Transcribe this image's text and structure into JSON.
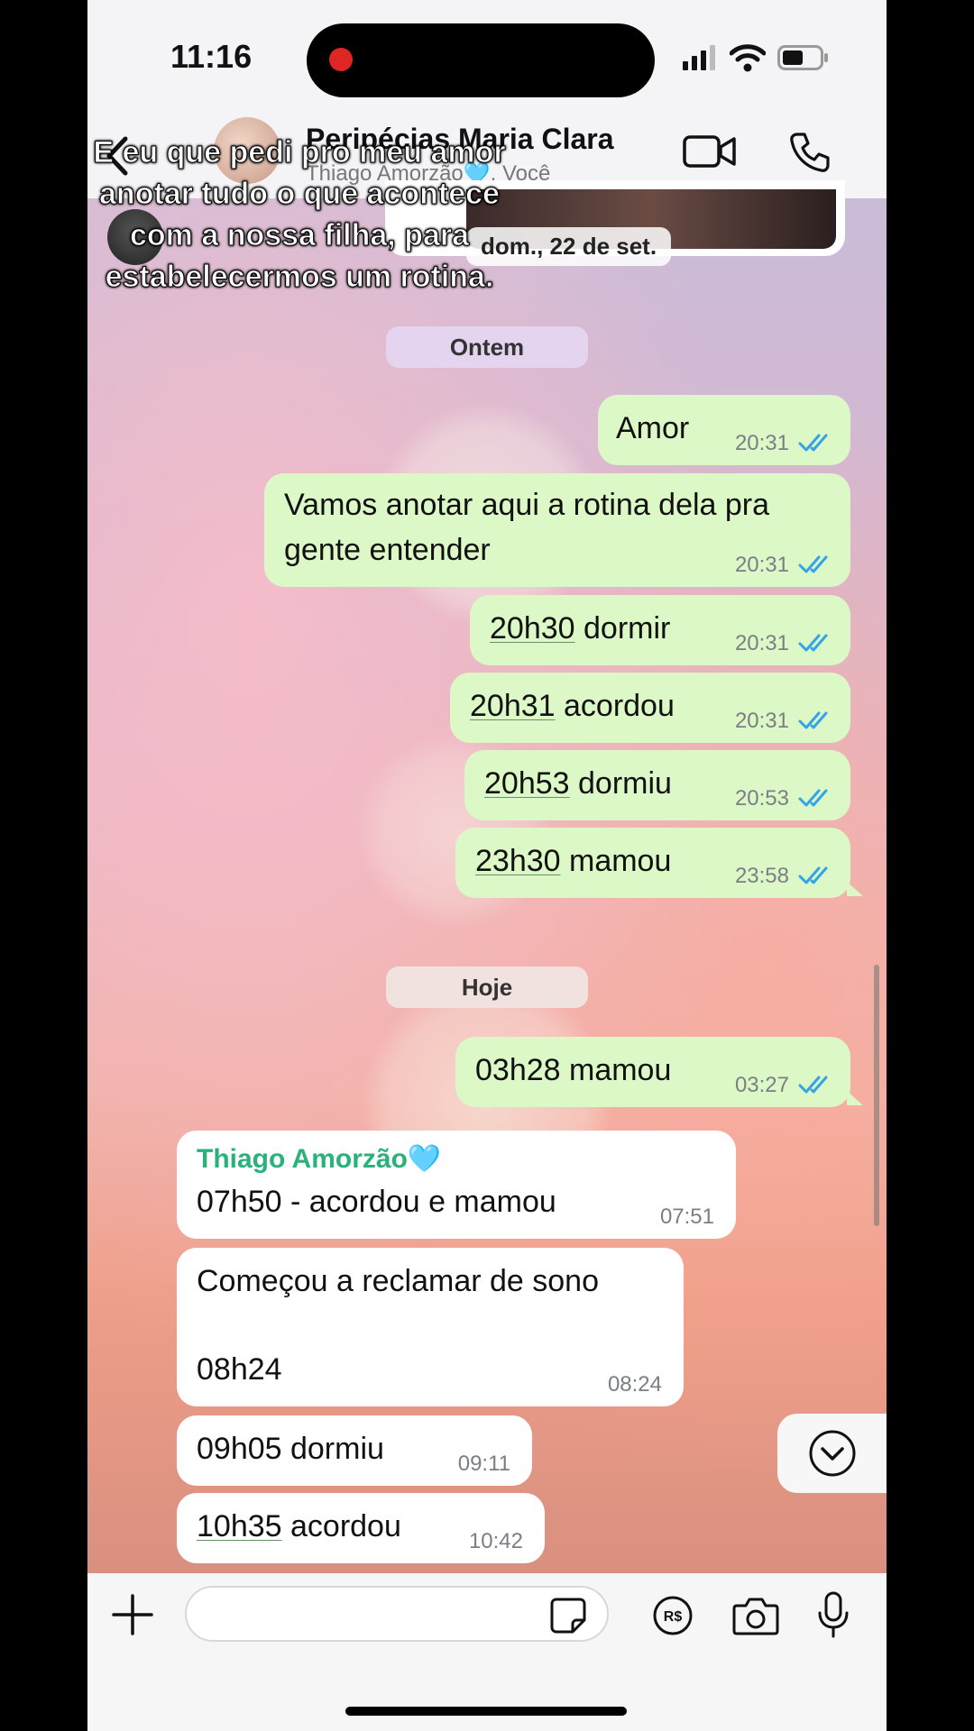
{
  "status_bar": {
    "time": "11:16"
  },
  "header": {
    "title": "Peripécias Maria Clara",
    "subtitle": "Thiago Amorzão🩵, Você",
    "back_icon": "chevron-left-icon",
    "video_icon": "video-camera-icon",
    "call_icon": "phone-icon"
  },
  "peek": {
    "date": "dom., 22 de set."
  },
  "overlay_caption": "E eu que pedi pro meu amor anotar tudo o que acontece com a nossa filha, para estabelecermos um rotina.",
  "date_labels": {
    "yesterday": "Ontem",
    "today": "Hoje"
  },
  "messages": [
    {
      "text": "Amor",
      "time": "20:31"
    },
    {
      "text_line1": "Vamos anotar aqui a rotina dela pra",
      "text_line2": "gente entender",
      "time": "20:31"
    },
    {
      "time_part": "20h30",
      "text": "dormir",
      "time": "20:31"
    },
    {
      "time_part": "20h31",
      "text": "acordou",
      "time": "20:31"
    },
    {
      "time_part": "20h53",
      "text": "dormiu",
      "time": "20:53"
    },
    {
      "time_part": "23h30",
      "text": "mamou",
      "time": "23:58"
    },
    {
      "text": "03h28 mamou",
      "time": "03:27"
    },
    {
      "sender": "Thiago Amorzão🩵",
      "text": "07h50 - acordou e mamou",
      "time": "07:51"
    },
    {
      "text_line1": "Começou a reclamar de sono",
      "text_line2": "08h24",
      "time": "08:24"
    },
    {
      "text": "09h05 dormiu",
      "time": "09:11"
    },
    {
      "time_part": "10h35",
      "text": "acordou",
      "time": "10:42"
    }
  ],
  "colors": {
    "outgoing_bubble": "#dcf8c6",
    "incoming_bubble": "#ffffff",
    "read_ticks": "#34a3e8",
    "sender_name": "#2bb17a"
  }
}
